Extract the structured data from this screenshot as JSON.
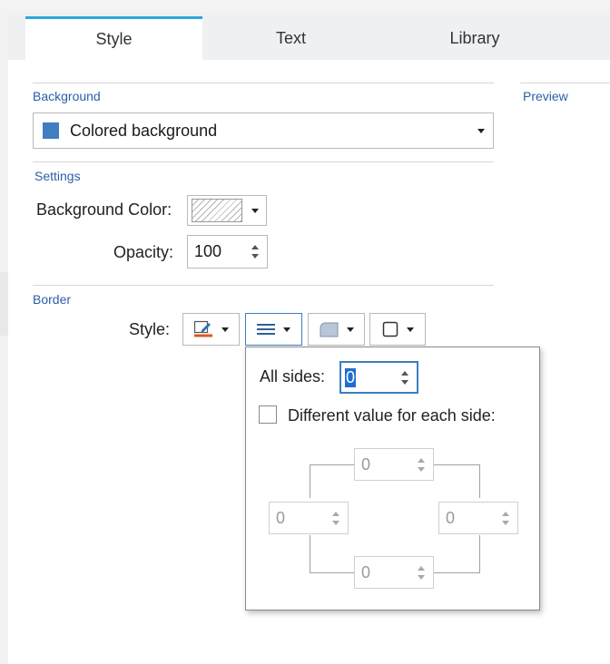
{
  "tabs": [
    {
      "label": "Style",
      "active": true
    },
    {
      "label": "Text",
      "active": false
    },
    {
      "label": "Library",
      "active": false
    }
  ],
  "background": {
    "section_label": "Background",
    "dropdown_value": "Colored background",
    "swatch_color": "#3f7fbf"
  },
  "preview": {
    "label": "Preview"
  },
  "settings": {
    "section_label": "Settings",
    "bg_color_label": "Background Color:",
    "opacity_label": "Opacity:",
    "opacity_value": "100"
  },
  "border": {
    "section_label": "Border",
    "style_label": "Style:",
    "buttons": [
      "pen-color-icon",
      "line-weight-icon",
      "corner-radius-icon",
      "border-box-icon"
    ]
  },
  "popup": {
    "all_sides_label": "All sides:",
    "all_sides_value": "0",
    "different_label": "Different value for each side:",
    "different_checked": false,
    "sides": {
      "top": "0",
      "left": "0",
      "right": "0",
      "bottom": "0"
    }
  },
  "colors": {
    "accent": "#2fa4dc",
    "section_label": "#2b5fa6",
    "selection": "#1f6fd0"
  }
}
